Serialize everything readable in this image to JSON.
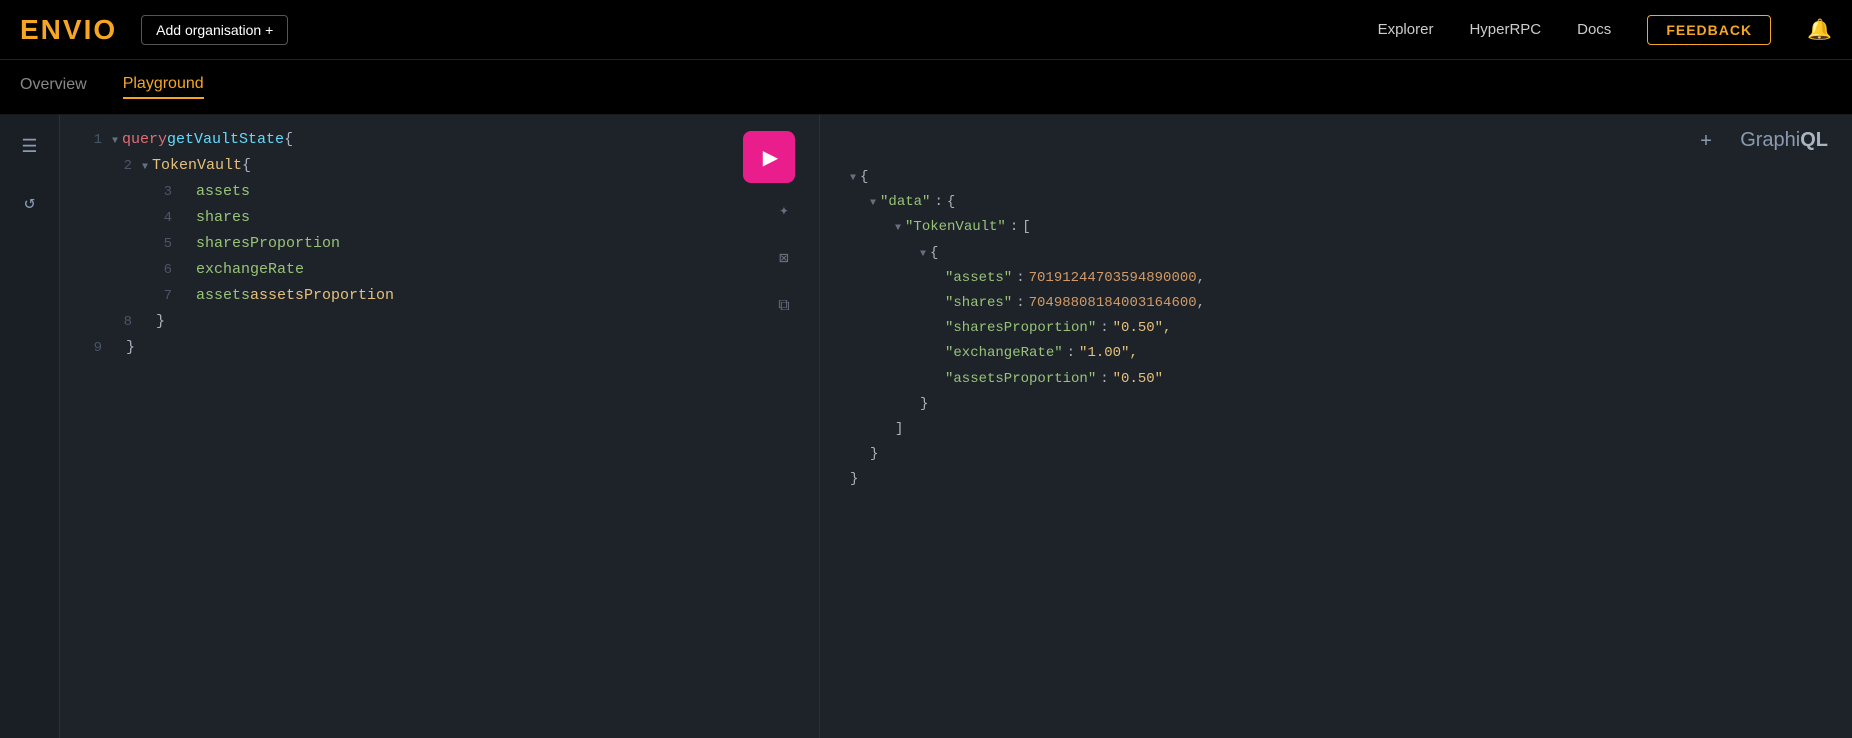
{
  "header": {
    "logo": "ENVIO",
    "add_org_label": "Add organisation +",
    "nav": {
      "explorer": "Explorer",
      "hyperrpc": "HyperRPC",
      "docs": "Docs"
    },
    "feedback_label": "FEEDBACK"
  },
  "sub_nav": {
    "items": [
      {
        "label": "Overview",
        "active": false
      },
      {
        "label": "Playground",
        "active": true
      }
    ]
  },
  "graphiql_label": "GraphiQL",
  "plus_label": "+",
  "editor": {
    "lines": [
      {
        "num": "1",
        "indent": 0,
        "collapsible": true,
        "content": "query getVaultState {"
      },
      {
        "num": "2",
        "indent": 1,
        "collapsible": true,
        "content": "TokenVault {"
      },
      {
        "num": "3",
        "indent": 2,
        "collapsible": false,
        "content": "assets"
      },
      {
        "num": "4",
        "indent": 2,
        "collapsible": false,
        "content": "shares"
      },
      {
        "num": "5",
        "indent": 2,
        "collapsible": false,
        "content": "sharesProportion"
      },
      {
        "num": "6",
        "indent": 2,
        "collapsible": false,
        "content": "exchangeRate"
      },
      {
        "num": "7",
        "indent": 2,
        "collapsible": false,
        "content": "assets assetsProportion"
      },
      {
        "num": "8",
        "indent": 1,
        "collapsible": false,
        "content": "}"
      },
      {
        "num": "9",
        "indent": 0,
        "collapsible": false,
        "content": "}"
      }
    ]
  },
  "result": {
    "json": {
      "assets_value": "70191244703594890000",
      "shares_value": "70498808184003164600",
      "sharesProportion_value": "0.50",
      "exchangeRate_value": "1.00",
      "assetsProportion_value": "0.50"
    }
  },
  "icons": {
    "sidebar_docs": "☰",
    "sidebar_history": "↺",
    "tool_magic": "✦",
    "tool_clear": "⊠",
    "tool_copy": "⧉",
    "bell": "🔔"
  }
}
